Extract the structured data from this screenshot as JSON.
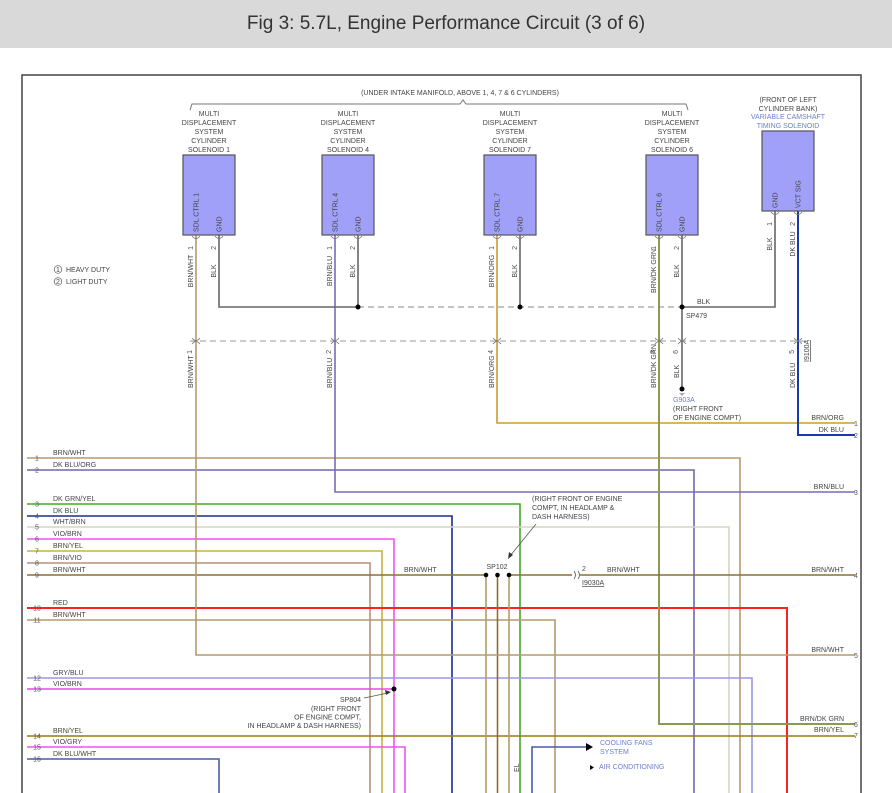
{
  "header": {
    "title": "Fig 3: 5.7L, Engine Performance Circuit (3 of 6)"
  },
  "diagram": {
    "location_note": "(UNDER INTAKE MANIFOLD, ABOVE 1, 4, 7 & 6 CYLINDERS)",
    "legend": [
      {
        "mark": "1",
        "label": "HEAVY DUTY"
      },
      {
        "mark": "2",
        "label": "LIGHT DUTY"
      }
    ],
    "components": [
      {
        "name_lines": [
          "MULTI",
          "DISPLACEMENT",
          "SYSTEM",
          "CYLINDER",
          "SOLENOID 1"
        ],
        "pins": [
          {
            "num": "1",
            "label": "SDL CTRL 1",
            "wire": "BRN/WHT"
          },
          {
            "num": "2",
            "label": "GND",
            "wire": "BLK"
          }
        ]
      },
      {
        "name_lines": [
          "MULTI",
          "DISPLACEMENT",
          "SYSTEM",
          "CYLINDER",
          "SOLENOID 4"
        ],
        "pins": [
          {
            "num": "1",
            "label": "SDL CTRL 4",
            "wire": "BRN/BLU"
          },
          {
            "num": "2",
            "label": "GND",
            "wire": "BLK"
          }
        ]
      },
      {
        "name_lines": [
          "MULTI",
          "DISPLACEMENT",
          "SYSTEM",
          "CYLINDER",
          "SOLENOID 7"
        ],
        "pins": [
          {
            "num": "1",
            "label": "SDL CTRL 7",
            "wire": "BRN/ORG"
          },
          {
            "num": "2",
            "label": "GND",
            "wire": "BLK"
          }
        ]
      },
      {
        "name_lines": [
          "MULTI",
          "DISPLACEMENT",
          "SYSTEM",
          "CYLINDER",
          "SOLENOID 6"
        ],
        "pins": [
          {
            "num": "1",
            "label": "SDL CTRL 6",
            "wire": "BRN/DK GRN"
          },
          {
            "num": "2",
            "label": "GND",
            "wire": "BLK"
          }
        ]
      },
      {
        "location_lines": [
          "(FRONT OF LEFT",
          "CYLINDER BANK)"
        ],
        "name_lines": [
          "VARIABLE CAMSHAFT",
          "TIMING SOLENOID"
        ],
        "pins": [
          {
            "num": "1",
            "label": "GND",
            "wire": "BLK"
          },
          {
            "num": "2",
            "label": "VCT SIG",
            "wire": "DK BLU"
          }
        ]
      }
    ],
    "ground_bus": {
      "wire": "BLK",
      "splice": "SP479",
      "down_wire": "BLK"
    },
    "connector": {
      "id": "I9100A",
      "pins": [
        {
          "num": "1",
          "wire": "BRN/WHT"
        },
        {
          "num": "2",
          "wire": "BRN/BLU"
        },
        {
          "num": "4",
          "wire": "BRN/ORG"
        },
        {
          "num": "3",
          "wire": "BRN/DK GRN"
        },
        {
          "num": "6",
          "wire": "BLK"
        },
        {
          "num": "5",
          "wire": "DK BLU"
        }
      ]
    },
    "ground": {
      "id": "G903A",
      "location_lines": [
        "(RIGHT FRONT",
        "OF ENGINE COMPT)"
      ]
    },
    "left_wires": [
      {
        "num": "1",
        "label": "BRN/WHT",
        "color": "#b49a6a"
      },
      {
        "num": "2",
        "label": "DK BLU/ORG",
        "color": "#6a6aa8"
      },
      {
        "num": "3",
        "label": "DK GRN/YEL",
        "color": "#44aa22"
      },
      {
        "num": "4",
        "label": "DK BLU",
        "color": "#1a2d8a"
      },
      {
        "num": "5",
        "label": "WHT/BRN",
        "color": "#d8d4c8"
      },
      {
        "num": "6",
        "label": "VIO/BRN",
        "color": "#ee55ee"
      },
      {
        "num": "7",
        "label": "BRN/YEL",
        "color": "#c8b040"
      },
      {
        "num": "8",
        "label": "BRN/VIO",
        "color": "#b8907a"
      },
      {
        "num": "9",
        "label": "BRN/WHT",
        "color": "#8a7030"
      },
      {
        "num": "10",
        "label": "RED",
        "color": "#ff2020"
      },
      {
        "num": "11",
        "label": "BRN/WHT",
        "color": "#b49a6a"
      },
      {
        "num": "12",
        "label": "GRY/BLU",
        "color": "#9a9ae0"
      },
      {
        "num": "13",
        "label": "VIO/BRN",
        "color": "#ee44ee"
      },
      {
        "num": "14",
        "label": "BRN/YEL",
        "color": "#9a7a10"
      },
      {
        "num": "15",
        "label": "VIO/GRY",
        "color": "#ee55ee"
      },
      {
        "num": "16",
        "label": "DK BLU/WHT",
        "color": "#4a5aa8"
      }
    ],
    "right_wires": [
      {
        "num": "1",
        "label": "BRN/ORG",
        "color": "#d09a30"
      },
      {
        "num": "2",
        "label": "DK BLU",
        "color": "#1a3aa8"
      },
      {
        "num": "3",
        "label": "BRN/BLU",
        "color": "#7a6ab8"
      },
      {
        "num": "4",
        "label": "BRN/WHT",
        "color": "#8a7030"
      },
      {
        "num": "5",
        "label": "BRN/WHT",
        "color": "#a08040"
      },
      {
        "num": "6",
        "label": "BRN/DK GRN",
        "color": "#8a9a50"
      },
      {
        "num": "7",
        "label": "BRN/YEL",
        "color": "#9a7a10"
      }
    ],
    "sp102": {
      "id": "SP102",
      "note_lines": [
        "(RIGHT FRONT OF ENGINE",
        "COMPT, IN HEADLAMP &",
        "DASH HARNESS)"
      ],
      "wire_left": "BRN/WHT",
      "inline_connector": {
        "id": "I9030A",
        "pin": "2"
      },
      "wire_after": "BRN/WHT"
    },
    "sp804": {
      "id": "SP804",
      "note_lines": [
        "(RIGHT FRONT",
        "OF ENGINE COMPT,",
        "IN HEADLAMP & DASH HARNESS)"
      ]
    },
    "references": [
      {
        "lines": [
          "COOLING FANS",
          "SYSTEM"
        ]
      },
      {
        "lines": [
          "AIR CONDITIONING"
        ]
      }
    ],
    "partial_label": "EL",
    "colors": {
      "component_fill": "#a0a0f8",
      "component_stroke": "#555555",
      "blk": "#666666",
      "frame": "#444444"
    }
  }
}
